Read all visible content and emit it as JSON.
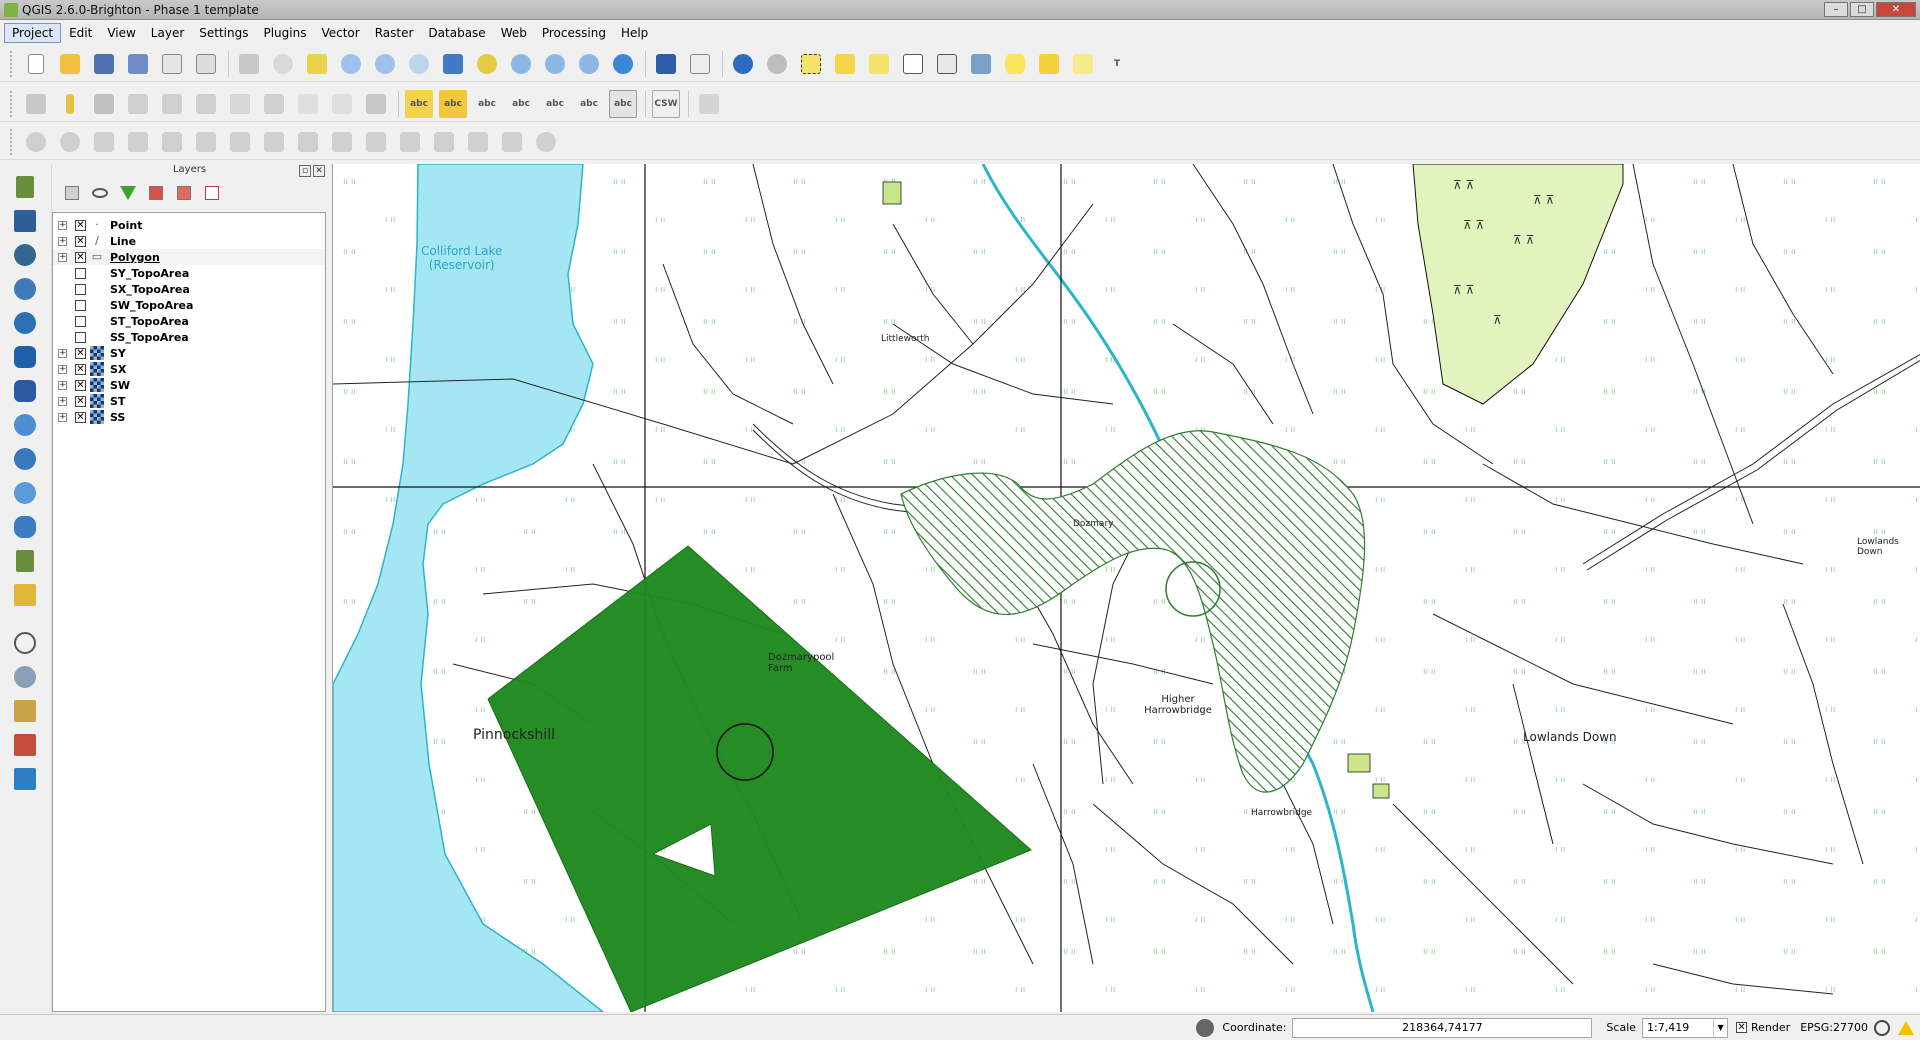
{
  "window": {
    "title": "QGIS 2.6.0-Brighton - Phase 1 template",
    "minimize": "–",
    "maximize": "□",
    "close": "✕"
  },
  "menu": [
    {
      "label": "Project",
      "active": true
    },
    {
      "label": "Edit"
    },
    {
      "label": "View"
    },
    {
      "label": "Layer"
    },
    {
      "label": "Settings"
    },
    {
      "label": "Plugins"
    },
    {
      "label": "Vector"
    },
    {
      "label": "Raster"
    },
    {
      "label": "Database"
    },
    {
      "label": "Web"
    },
    {
      "label": "Processing"
    },
    {
      "label": "Help"
    }
  ],
  "toolbar_text": {
    "csw": "CSW",
    "label_abc": "abc",
    "text_tool": "T"
  },
  "layers_panel": {
    "title": "Layers",
    "dock_btn": "▫",
    "close_btn": "✕"
  },
  "layers": [
    {
      "name": "Point",
      "checked": true,
      "expandable": true,
      "icon": "point-symbol-icon",
      "glyph": "·"
    },
    {
      "name": "Line",
      "checked": true,
      "expandable": true,
      "icon": "line-symbol-icon",
      "glyph": "∕"
    },
    {
      "name": "Polygon",
      "checked": true,
      "expandable": true,
      "icon": "polygon-symbol-icon",
      "glyph": "▭",
      "selected": true
    },
    {
      "name": "SY_TopoArea",
      "checked": false,
      "expandable": false,
      "icon": "none"
    },
    {
      "name": "SX_TopoArea",
      "checked": false,
      "expandable": false,
      "icon": "none"
    },
    {
      "name": "SW_TopoArea",
      "checked": false,
      "expandable": false,
      "icon": "none"
    },
    {
      "name": "ST_TopoArea",
      "checked": false,
      "expandable": false,
      "icon": "none"
    },
    {
      "name": "SS_TopoArea",
      "checked": false,
      "expandable": false,
      "icon": "none"
    },
    {
      "name": "SY",
      "checked": true,
      "expandable": true,
      "icon": "raster-layer-icon"
    },
    {
      "name": "SX",
      "checked": true,
      "expandable": true,
      "icon": "raster-layer-icon"
    },
    {
      "name": "SW",
      "checked": true,
      "expandable": true,
      "icon": "raster-layer-icon"
    },
    {
      "name": "ST",
      "checked": true,
      "expandable": true,
      "icon": "raster-layer-icon"
    },
    {
      "name": "SS",
      "checked": true,
      "expandable": true,
      "icon": "raster-layer-icon"
    }
  ],
  "map_labels": {
    "lake": "Colliford Lake",
    "reservoir": "(Reservoir)",
    "pinnockshill": "Pinnockshill",
    "lowlands_down": "Lowlands Down",
    "higher_harrowbridge": "Higher Harrowbridge",
    "harrowbridge": "Harrowbridge",
    "dozmarypool_farm": "Dozmarypool Farm",
    "dozmary": "Dozmary",
    "lowlands_down_right": "Lowlands Down",
    "littleworth": "Littleworth"
  },
  "colors": {
    "solid_polygon": "#1f8a1f",
    "hatched_polygon": "#2f7d2f",
    "water": "#a5e6f4",
    "woodland": "#e2f4bd",
    "menu_active": "#dce6f7"
  },
  "status": {
    "coordinate_label": "Coordinate:",
    "coordinate_value": "218364,74177",
    "scale_label": "Scale",
    "scale_value": "1:7,419",
    "render_label": "Render",
    "render_checked": true,
    "crs": "EPSG:27700"
  }
}
